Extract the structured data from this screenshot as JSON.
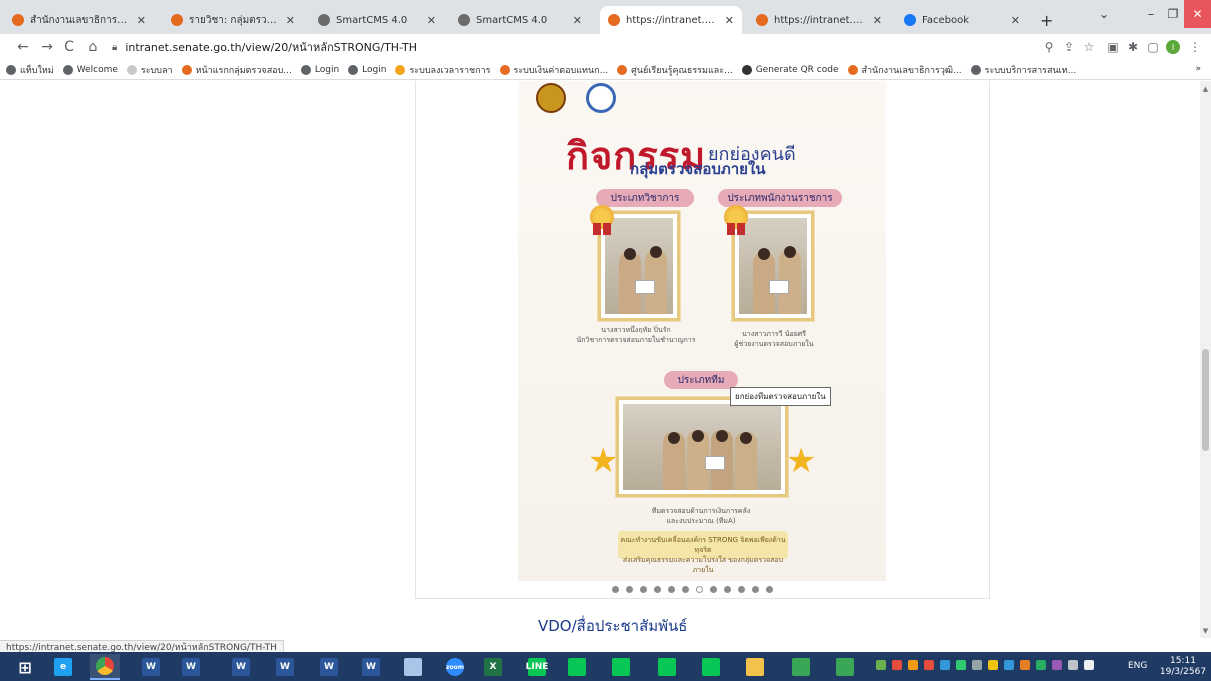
{
  "browser": {
    "tabs": [
      {
        "title": "สำนักงานเลขาธิการวุฒิสภา",
        "color": "#e46a1f",
        "active": false
      },
      {
        "title": "รายวิชา: กลุ่มตรวจสอบภายใ",
        "color": "#e46a1f",
        "active": false
      },
      {
        "title": "SmartCMS 4.0",
        "color": "#6b6b6b",
        "active": false
      },
      {
        "title": "SmartCMS 4.0",
        "color": "#6b6b6b",
        "active": false
      },
      {
        "title": "https://intranet.senate.go",
        "color": "#e46a1f",
        "active": true
      },
      {
        "title": "https://intranet.senate.go",
        "color": "#e46a1f",
        "active": false
      },
      {
        "title": "Facebook",
        "color": "#1877f2",
        "active": false
      }
    ],
    "new_tab": "+",
    "address": "intranet.senate.go.th/view/20/หน้าหลักSTRONG/TH-TH",
    "profile_initial": "I",
    "bookmarks": [
      {
        "label": "แท็บใหม่",
        "color": "#5f6368"
      },
      {
        "label": "Welcome",
        "color": "#5f6368"
      },
      {
        "label": "ระบบลา",
        "color": "#c9c9c9"
      },
      {
        "label": "หน้าแรกกลุ่มตรวจสอบ...",
        "color": "#e46a1f"
      },
      {
        "label": "Login",
        "color": "#5f6368"
      },
      {
        "label": "Login",
        "color": "#5f6368"
      },
      {
        "label": "ระบบลงเวลาราชการ",
        "color": "#f2a31b"
      },
      {
        "label": "ระบบเงินค่าตอบแทนก...",
        "color": "#e46a1f"
      },
      {
        "label": "ศูนย์เรียนรู้คุณธรรมและ...",
        "color": "#e46a1f"
      },
      {
        "label": "Generate QR code",
        "color": "#333333"
      },
      {
        "label": "สำนักงานเลขาธิการวุฒิ...",
        "color": "#e46a1f"
      },
      {
        "label": "ระบบบริการสารสนเท...",
        "color": "#5f6368"
      }
    ],
    "bookmarks_more": "»"
  },
  "poster": {
    "title_big": "กิจกรรม",
    "title_small": "ยกย่องคนดี",
    "subtitle": "กลุ่มตรวจสอบภายใน",
    "category_1": "ประเภทวิชาการ",
    "category_2": "ประเภทพนักงานราชการ",
    "category_3": "ประเภททีม",
    "caption_1": "นางสาวหนึ่งฤทัย ปิ่นรัก\nนักวิชาการตรวจสอบภายในชำนาญการ",
    "caption_2": "นางสาวภารวี น้อยศรี\nผู้ช่วยงานตรวจสอบภายใน",
    "caption_3": "ทีมตรวจสอบด้านการเงินการคลัง\nและงบประมาณ (ทีมA)",
    "footer": "คณะทำงานขับเคลื่อนองค์กร STRONG จิตพอเพียงต้านทุจริต\nส่งเสริมคุณธรรมและความโปร่งใส ของกลุ่มตรวจสอบภายใน"
  },
  "tooltip": "ยกย่องทีมตรวจสอบภายใน",
  "carousel": {
    "count": 12,
    "active_index": 6
  },
  "section_title": "VDO/สื่อประชาสัมพันธ์",
  "status_url": "https://intranet.senate.go.th/view/20/หน้าหลักSTRONG/TH-TH",
  "taskbar": {
    "apps": [
      {
        "name": "windows-start",
        "color": "#ffffff",
        "label": ""
      },
      {
        "name": "internet-explorer",
        "color": "#1ea1f1",
        "label": "e"
      },
      {
        "name": "chrome",
        "color": "#e8453c",
        "label": ""
      },
      {
        "name": "word-1",
        "color": "#2b579a",
        "label": "W"
      },
      {
        "name": "word-2",
        "color": "#2b579a",
        "label": "W"
      },
      {
        "name": "word-3",
        "color": "#2b579a",
        "label": "W"
      },
      {
        "name": "word-4",
        "color": "#2b579a",
        "label": "W"
      },
      {
        "name": "word-5",
        "color": "#2b579a",
        "label": "W"
      },
      {
        "name": "word-6",
        "color": "#2b579a",
        "label": "W"
      },
      {
        "name": "paint",
        "color": "#a8c7e8",
        "label": ""
      },
      {
        "name": "zoom",
        "color": "#2d8cff",
        "label": "zoom"
      },
      {
        "name": "excel",
        "color": "#217346",
        "label": "X"
      },
      {
        "name": "line",
        "color": "#06c755",
        "label": "LINE"
      },
      {
        "name": "line-2",
        "color": "#06c755",
        "label": ""
      },
      {
        "name": "line-3",
        "color": "#06c755",
        "label": ""
      },
      {
        "name": "line-4",
        "color": "#06c755",
        "label": ""
      },
      {
        "name": "line-5",
        "color": "#06c755",
        "label": ""
      },
      {
        "name": "file-explorer",
        "color": "#f3c24b",
        "label": ""
      },
      {
        "name": "app-green-1",
        "color": "#3aa757",
        "label": ""
      },
      {
        "name": "app-green-2",
        "color": "#3aa757",
        "label": ""
      }
    ],
    "lang": "ENG",
    "time": "15:11",
    "date": "19/3/2567"
  }
}
